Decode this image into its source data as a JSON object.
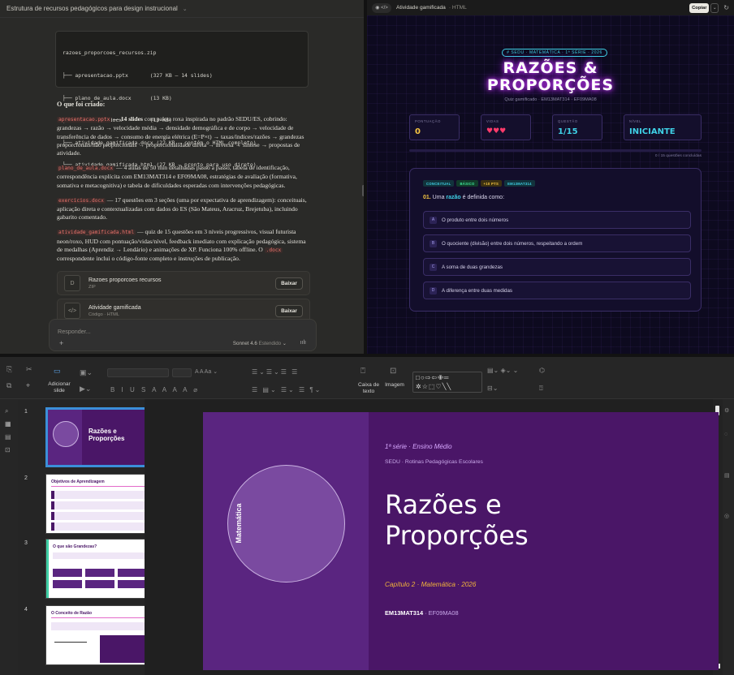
{
  "chat": {
    "title": "Estrutura de recursos pedagógicos para design instrucional",
    "code_lines": [
      "razoes_proporcoes_recursos.zip",
      "├── apresentacao.pptx       (327 KB — 14 slides)",
      "├── plano_de_aula.docx      (13 KB)",
      "├── exercicios.docx         (13 KB)",
      "├── atividade_gamificada.docx (22 KB — contém o HTML completo)",
      "└── atividade_gamificada.html (27 KB — pronto para uso direto)"
    ],
    "heading": "O que foi criado:",
    "p1_tag": "apresentacao.pptx",
    "p1_bold": " — 14 slides",
    "p1_text": " com paleta roxa inspirada no padrão SEDU/ES, cobrindo: grandezas → razão → velocidade média → densidade demográfica e de corpo → velocidade de transferência de dados → consumo de energia elétrica (E=P×t) → taxas/índices/razões → grandezas proporcionais/não proporcionais → proporcionalidade direta → inversa → síntese → propostas de atividade.",
    "p2_tag": "plano_de_aula.docx",
    "p2_text": " — 4 aulas de 50 min detalhadas passo a passo, tabela de identificação, correspondência explícita com EM13MAT314 e EF09MA08, estratégias de avaliação (formativa, somativa e metacognitiva) e tabela de dificuldades esperadas com intervenções pedagógicas.",
    "p3_tag": "exercicios.docx",
    "p3_text": " — 17 questões em 3 seções (uma por expectativa de aprendizagem): conceituais, aplicação direta e contextualizadas com dados do ES (São Mateus, Aracruz, Brejetuba), incluindo gabarito comentado.",
    "p4_tag": "atividade_gamificada.html",
    "p4_text": " — quiz de 15 questões em 3 níveis progressivos, visual futurista neon/roxo, HUD com pontuação/vidas/nível, feedback imediato com explicação pedagógica, sistema de medalhas (Aprendiz → Lendário) e animações de XP. Funciona 100% offline. O ",
    "p4_tag2": ".docx",
    "p4_text2": " correspondente inclui o código-fonte completo e instruções de publicação.",
    "files": [
      {
        "name": "Razoes proporcoes recursos",
        "type": "ZIP",
        "icon": "D",
        "button": "Baixar"
      },
      {
        "name": "Atividade gamificada",
        "type": "Código · HTML",
        "icon": "</>",
        "button": "Baixar"
      }
    ],
    "composer_placeholder": "Responder...",
    "model": "Sonnet 4.6",
    "model_mode": "Estendido",
    "plus": "+",
    "wave": "ıılı"
  },
  "artifact": {
    "toggle_icons": "◉ </>",
    "title": "Atividade gamificada",
    "type": "· HTML",
    "copy": "Copiar",
    "dropdown": "⌄",
    "refresh": "↻",
    "badge": "# SEDU · MATEMÁTICA · 1ª SÉRIE · 2026",
    "game_title_1": "RAZÕES &",
    "game_title_2": "PROPORÇÕES",
    "game_sub": "Quiz gamificado · EM13MAT314 · EF09MA08",
    "stats": [
      {
        "label": "PONTUAÇÃO",
        "value": "0",
        "color": "#f5c542"
      },
      {
        "label": "VIDAS",
        "value": "♥♥♥",
        "color": "#ff3b6b"
      },
      {
        "label": "QUESTÃO",
        "value": "1/15",
        "color": "#3fd0e6"
      },
      {
        "label": "NÍVEL",
        "value": "INICIANTE",
        "color": "#3fd0e6"
      }
    ],
    "progress_fraction": 0.0,
    "progress_text": "0 / 15 questões concluídas",
    "pills": [
      {
        "text": "CONCEITUAL",
        "bg": "#12333c",
        "fg": "#3fd0e6"
      },
      {
        "text": "BÁSICO",
        "bg": "#123c2a",
        "fg": "#3fe69a"
      },
      {
        "text": "+10 PTS",
        "bg": "#3c3012",
        "fg": "#f5c542"
      },
      {
        "text": "EM13MAT314",
        "bg": "#12333c",
        "fg": "#3fd0e6"
      }
    ],
    "q_num": "01.",
    "q_pre": " Uma ",
    "q_hl": "razão",
    "q_post": " é definida como:",
    "options": [
      {
        "key": "A",
        "text": "O produto entre dois números"
      },
      {
        "key": "B",
        "text": "O quociente (divisão) entre dois números, respeitando a ordem"
      },
      {
        "key": "C",
        "text": "A soma de duas grandezas"
      },
      {
        "key": "D",
        "text": "A diferença entre duas medidas"
      }
    ]
  },
  "impress": {
    "add_slide": "Adicionar slide",
    "text_box": "Caixa de texto",
    "image": "Imagem",
    "shapes_row1": "□○⇨⇦✙═",
    "shapes_row2": "✲☆⬚♡╲╲",
    "thumb_numbers": [
      "1",
      "2",
      "3",
      "4"
    ],
    "thumbs": [
      {
        "title": "Razões e Proporções"
      },
      {
        "title": "Objetivos de Aprendizagem"
      },
      {
        "title": "O que são Grandezas?"
      },
      {
        "title": "O Conceito de Razão"
      }
    ],
    "slide": {
      "serie": "1ª série · Ensino Médio",
      "sedu": "SEDU · Rotinas Pedagógicas Escolares",
      "title_1": "Razões e",
      "title_2": "Proporções",
      "chapter": "Capítulo 2 · Matemática · 2026",
      "code1": "EM13MAT314",
      "code2": " · EF09MA08",
      "vertical": "Matemática"
    }
  }
}
